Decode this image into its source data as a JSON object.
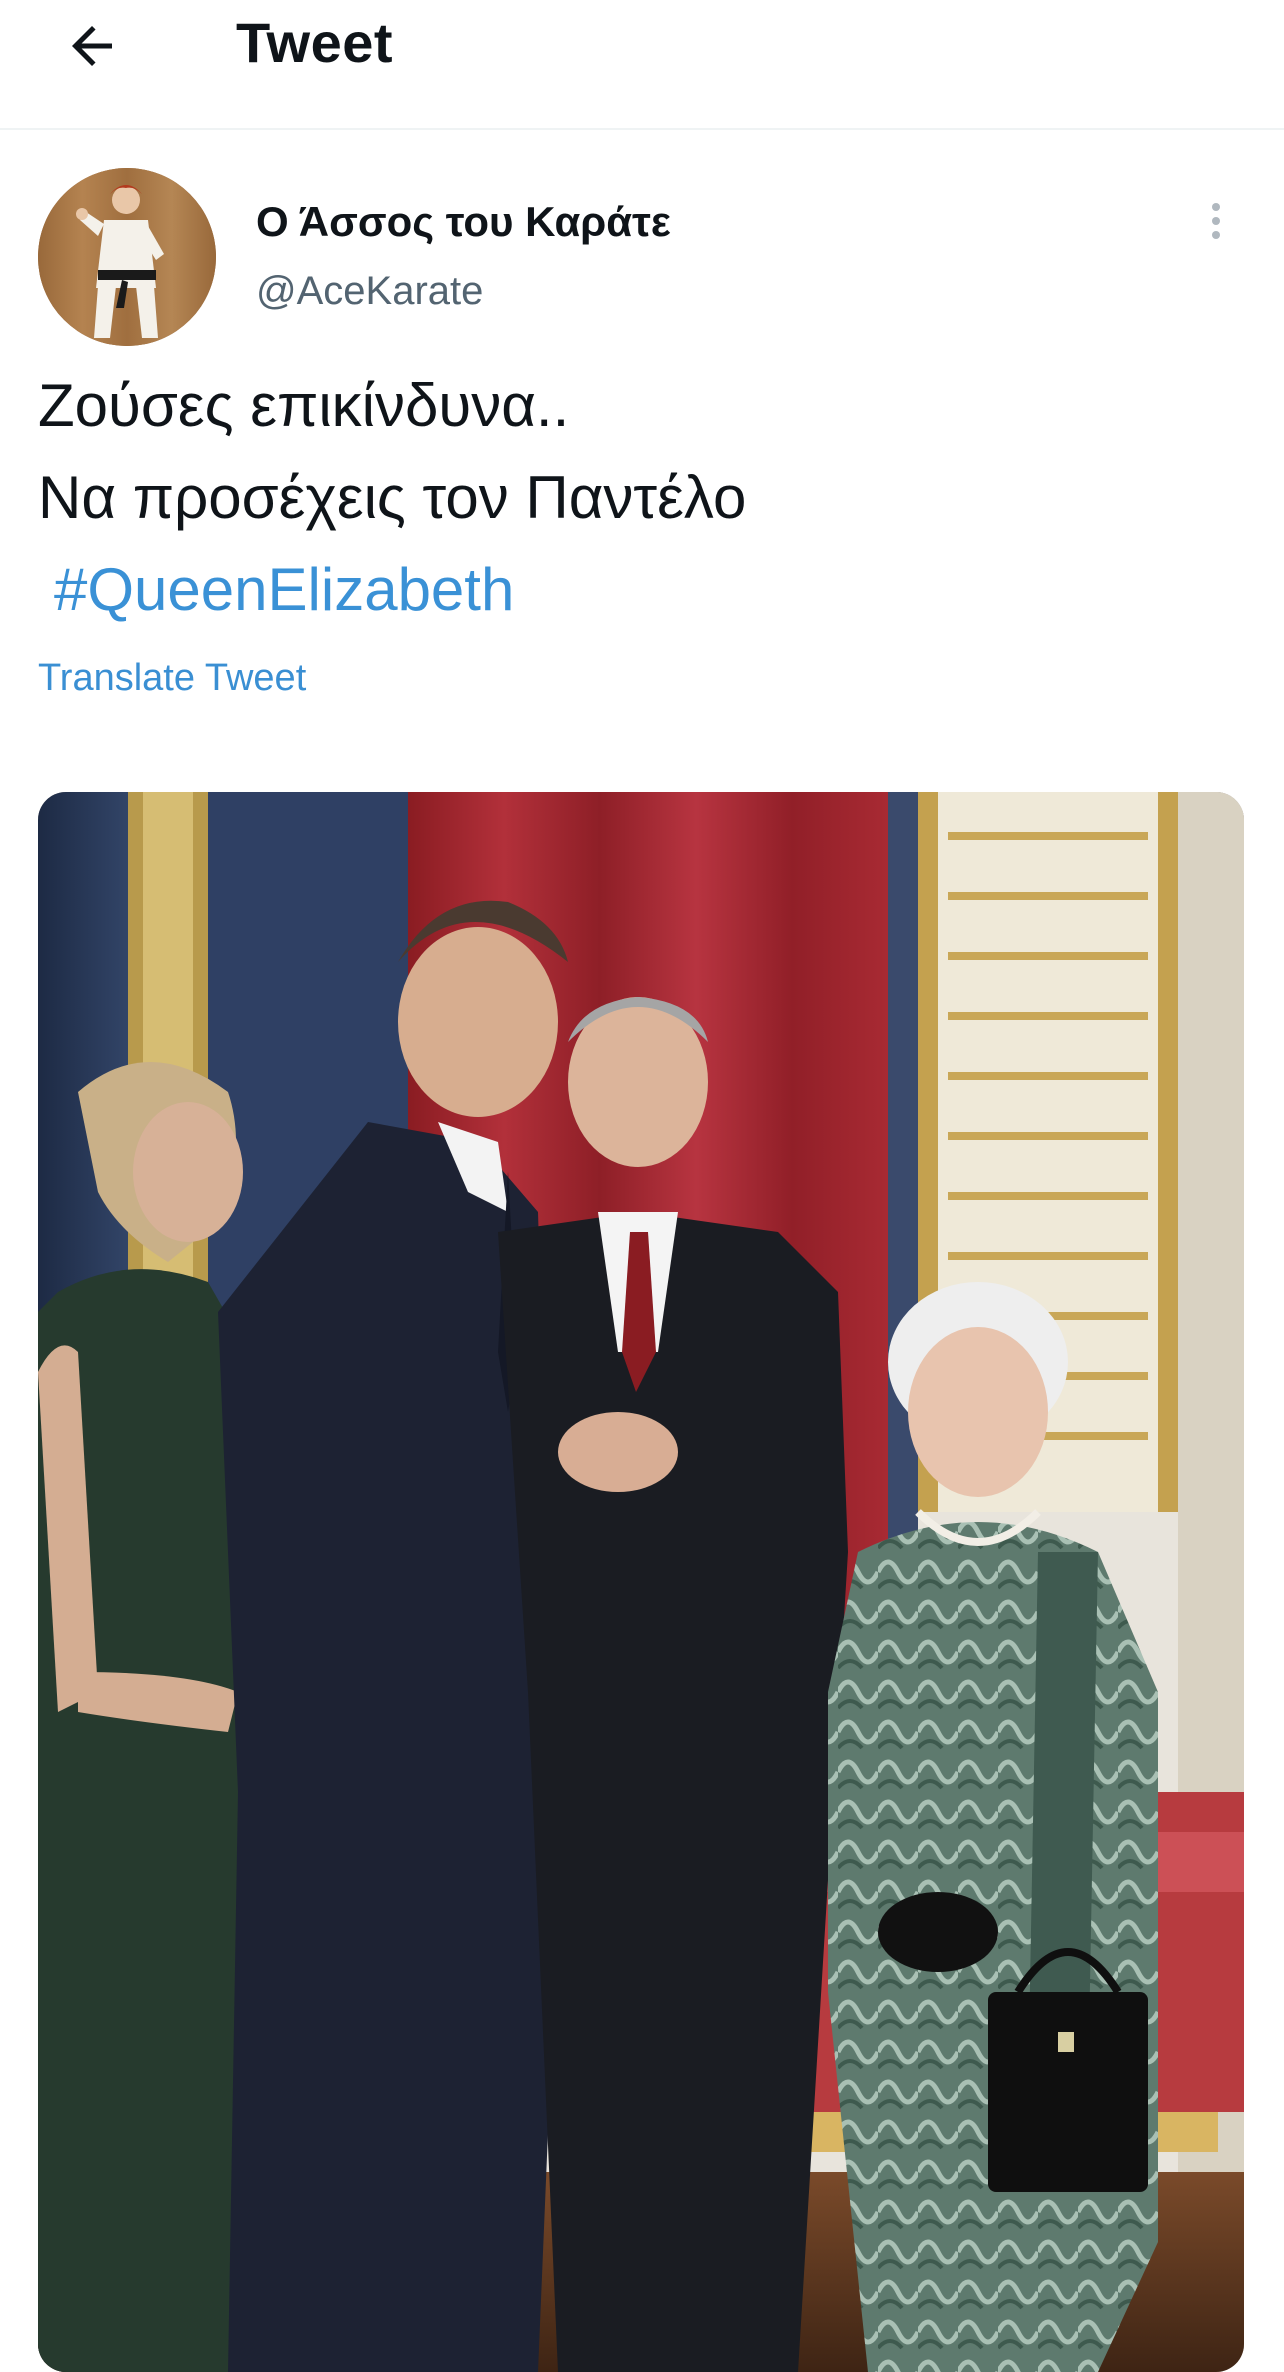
{
  "header": {
    "title": "Tweet",
    "back_icon": "arrow-left-icon"
  },
  "tweet": {
    "author": {
      "display_name": "Ο Άσσος του Καράτε",
      "handle": "@AceKarate",
      "avatar_icon": "karate-figure-avatar"
    },
    "text_lines": [
      "Ζούσες επικίνδυνα..",
      "Να προσέχεις τον Παντέλο"
    ],
    "hashtag": "#QueenElizabeth",
    "translate_label": "Translate Tweet",
    "more_icon": "more-vertical-icon",
    "media": {
      "kind": "photo",
      "icon": "photo-four-people-palace-room"
    }
  },
  "colors": {
    "accent": "#1d9bf0",
    "link": "#3a8fd3",
    "secondary_text": "#536471",
    "divider": "#eff3f4"
  }
}
